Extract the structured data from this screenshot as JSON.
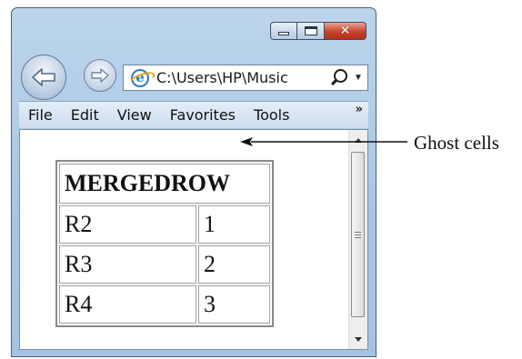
{
  "address": {
    "url_text": "C:\\Users\\HP\\Music"
  },
  "menu": {
    "items": [
      "File",
      "Edit",
      "View",
      "Favorites",
      "Tools"
    ],
    "more": "»"
  },
  "table": {
    "header": "MERGEDROW",
    "rows": [
      [
        "R2",
        "1"
      ],
      [
        "R3",
        "2"
      ],
      [
        "R4",
        "3"
      ]
    ]
  },
  "annotation": {
    "label": "Ghost cells"
  },
  "icons": {
    "back": "back-arrow-icon",
    "forward": "forward-arrow-icon",
    "browser": "internet-explorer-icon",
    "search": "search-icon",
    "dropdown": "chevron-down-icon",
    "minimize": "minimize-icon",
    "maximize": "maximize-icon",
    "close": "close-icon"
  },
  "colors": {
    "frame": "#a7c6e4",
    "close_button": "#c7432c",
    "ie_blue": "#2d79c7",
    "ie_orange": "#e8a418"
  }
}
